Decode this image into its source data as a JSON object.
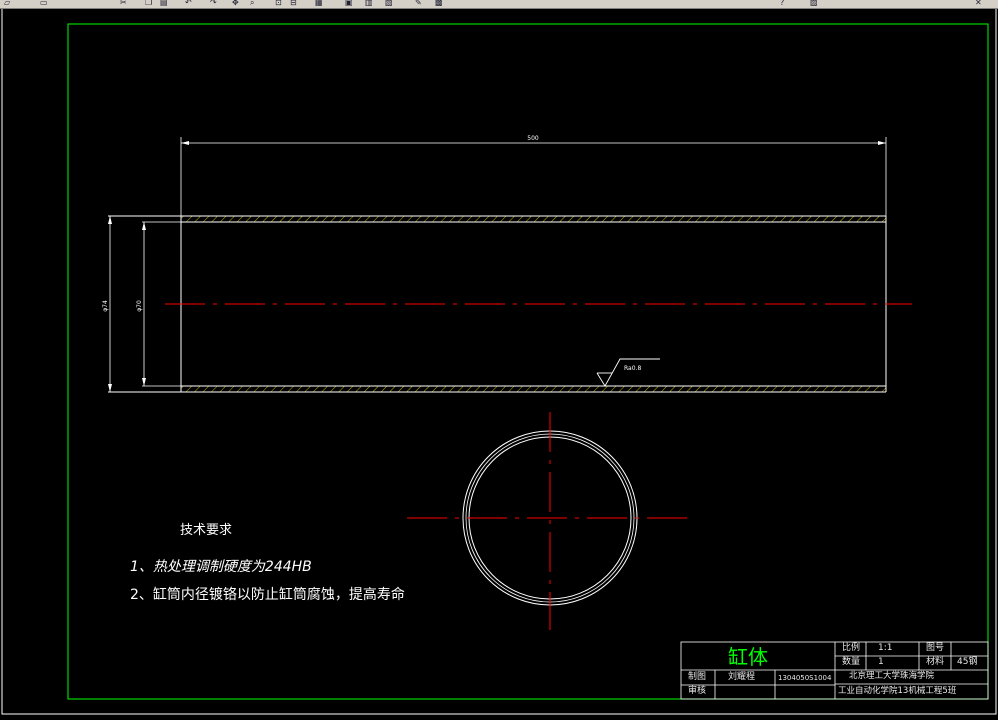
{
  "toolbar": {
    "icons": [
      "open-icon",
      "save-icon",
      "cut-icon",
      "copy-icon",
      "paste-icon",
      "undo-icon",
      "redo-icon",
      "pan-icon",
      "zoom-icon",
      "zoom-window-icon",
      "zoom-previous-icon",
      "properties-icon",
      "design-center-icon",
      "tool-palette-icon",
      "sheet-set-icon",
      "markup-icon",
      "calculator-icon",
      "help-icon",
      "layer-icon",
      "close-icon"
    ]
  },
  "drawing": {
    "length_dimension": "500",
    "outer_diameter_label": "φ74",
    "inner_diameter_label": "φ70",
    "roughness_label": "Ra0.8",
    "colors": {
      "frame": "#00ff00",
      "geometry": "#ffffff",
      "centerline": "#ff0000",
      "hatch": "#c8b400"
    }
  },
  "tech_requirements": {
    "title": "技术要求",
    "item1": "1、热处理调制硬度为244HB",
    "item2": "2、缸筒内径镀铬以防止缸筒腐蚀，提高寿命"
  },
  "title_block": {
    "part_name": "缸体",
    "scale_label": "比例",
    "scale_value": "1:1",
    "drawing_no_label": "图号",
    "drawing_no_value": "",
    "quantity_label": "数量",
    "quantity_value": "1",
    "material_label": "材料",
    "material_value": "45钢",
    "drawn_label": "制图",
    "drawn_by": "刘耀程",
    "student_id": "1304050S1004",
    "check_label": "审核",
    "school": "北京理工大学珠海学院",
    "class": "工业自动化学院13机械工程5班"
  }
}
